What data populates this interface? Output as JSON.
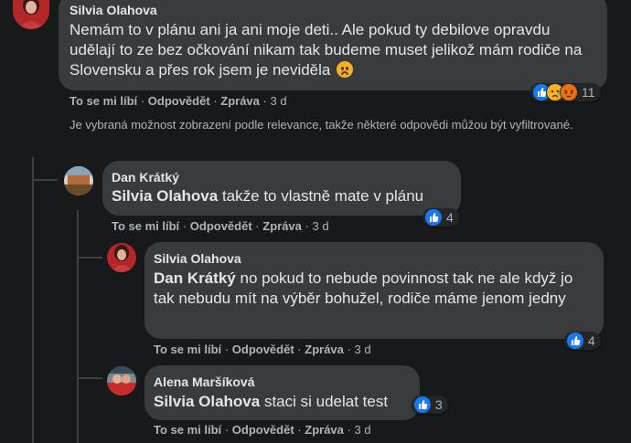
{
  "notice": "Je vybraná možnost zobrazení podle relevance, takže některé odpovědi můžou být vyfiltrované.",
  "labels": {
    "like": "To se mi líbí",
    "reply": "Odpovědět",
    "message": "Zpráva",
    "sep": "·"
  },
  "comments": [
    {
      "author": "Silvia Olahova",
      "text": "Nemám to v plánu ani ja ani moje deti.. Ale pokud ty debilove opravdu udělají to ze bez očkování nikam tak budeme muset jelikož mám rodiče na Slovensku a přes rok jsem je neviděla",
      "emoji": "frowning-face",
      "time": "3 d",
      "reaction_icons": [
        "like-icon",
        "sad-icon",
        "angry-icon"
      ],
      "reaction_count": "11"
    },
    {
      "author": "Dan Krátký",
      "mention": "Silvia Olahova",
      "text": " takže to vlastně mate v plánu",
      "time": "3 d",
      "reaction_icons": [
        "like-icon"
      ],
      "reaction_count": "4"
    },
    {
      "author": "Silvia Olahova",
      "mention": "Dan Krátký",
      "text": " no pokud to nebude povinnost tak ne ale když jo tak nebudu mít na výběr bohužel, rodiče máme jenom jedny",
      "time": "3 d",
      "reaction_icons": [
        "like-icon"
      ],
      "reaction_count": "4"
    },
    {
      "author": "Alena Maršíková",
      "mention": "Silvia Olahova",
      "text": " staci si udelat test",
      "time": "3 d",
      "reaction_icons": [
        "like-icon"
      ],
      "reaction_count": "3"
    }
  ],
  "colors": {
    "background": "#18191a",
    "bubble": "#3a3b3c",
    "like": "#1877f2",
    "haha_sad": "#f7b125",
    "angry": "#e9710f"
  }
}
